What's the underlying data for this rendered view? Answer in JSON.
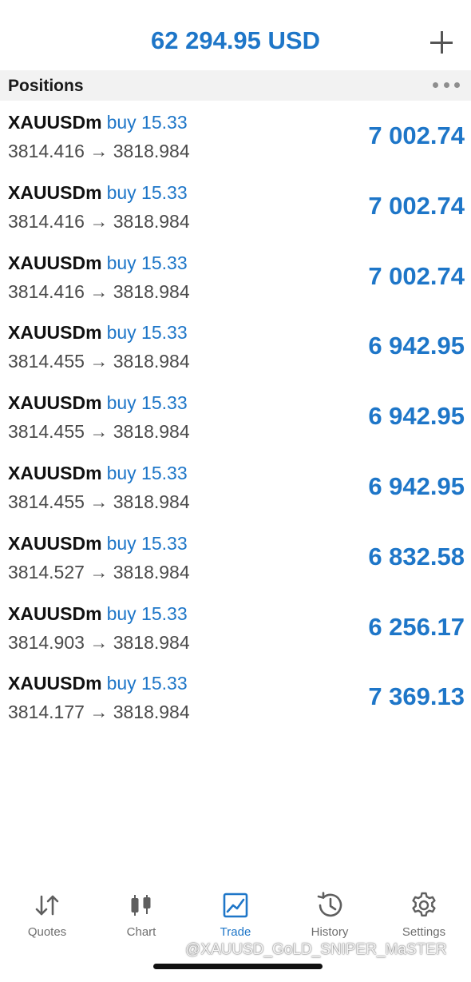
{
  "header": {
    "balance": "62 294.95 USD"
  },
  "section": {
    "title": "Positions"
  },
  "positions": [
    {
      "symbol": "XAUUSDm",
      "side": "buy 15.33",
      "prices": "3814.416 → 3818.984",
      "profit": "7 002.74"
    },
    {
      "symbol": "XAUUSDm",
      "side": "buy 15.33",
      "prices": "3814.416 → 3818.984",
      "profit": "7 002.74"
    },
    {
      "symbol": "XAUUSDm",
      "side": "buy 15.33",
      "prices": "3814.416 → 3818.984",
      "profit": "7 002.74"
    },
    {
      "symbol": "XAUUSDm",
      "side": "buy 15.33",
      "prices": "3814.455 → 3818.984",
      "profit": "6 942.95"
    },
    {
      "symbol": "XAUUSDm",
      "side": "buy 15.33",
      "prices": "3814.455 → 3818.984",
      "profit": "6 942.95"
    },
    {
      "symbol": "XAUUSDm",
      "side": "buy 15.33",
      "prices": "3814.455 → 3818.984",
      "profit": "6 942.95"
    },
    {
      "symbol": "XAUUSDm",
      "side": "buy 15.33",
      "prices": "3814.527 → 3818.984",
      "profit": "6 832.58"
    },
    {
      "symbol": "XAUUSDm",
      "side": "buy 15.33",
      "prices": "3814.903 → 3818.984",
      "profit": "6 256.17"
    },
    {
      "symbol": "XAUUSDm",
      "side": "buy 15.33",
      "prices": "3814.177 → 3818.984",
      "profit": "7 369.13"
    }
  ],
  "tabs": [
    {
      "label": "Quotes",
      "icon": "quotes-arrows-icon",
      "active": false
    },
    {
      "label": "Chart",
      "icon": "candlestick-chart-icon",
      "active": false
    },
    {
      "label": "Trade",
      "icon": "trade-line-chart-icon",
      "active": true
    },
    {
      "label": "History",
      "icon": "history-clock-icon",
      "active": false
    },
    {
      "label": "Settings",
      "icon": "settings-gear-icon",
      "active": false
    }
  ],
  "watermark": "@XAUUSD_GoLD_SNIPER_MaSTER",
  "colors": {
    "accent": "#1e76c8",
    "text": "#1a1a1a",
    "secondary_text": "#4a4a4a",
    "section_bg": "#f2f2f2",
    "tab_inactive": "#6e6e6e"
  }
}
